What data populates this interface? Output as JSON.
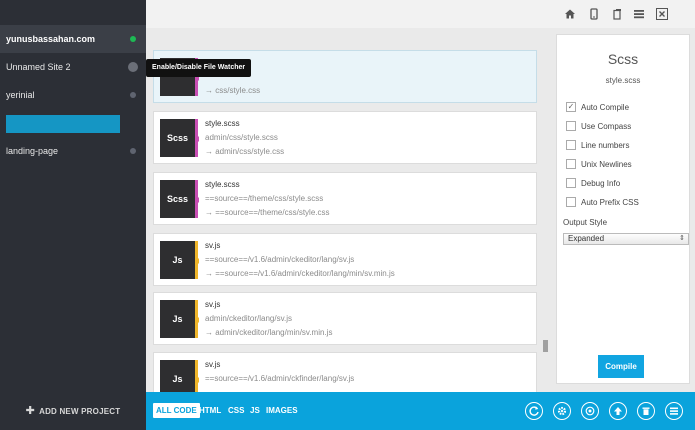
{
  "sidebar": {
    "projects": [
      {
        "name": "yunusbassahan.com",
        "active": true
      },
      {
        "name": "Unnamed Site 2"
      },
      {
        "name": "yerinial"
      },
      {
        "name": "landing-page"
      }
    ],
    "add_project_label": "ADD NEW PROJECT"
  },
  "tooltip": "Enable/Disable File Watcher",
  "topbar_icons": [
    "home-icon",
    "mobile-icon",
    "copy-icon",
    "menu-icon",
    "close-icon"
  ],
  "files": [
    {
      "badge": "",
      "name": "",
      "source": "",
      "output": "→ css/style.css",
      "type": "scss"
    },
    {
      "badge": "Scss",
      "name": "style.scss",
      "source": "admin/css/style.scss",
      "output": "→ admin/css/style.css",
      "type": "scss"
    },
    {
      "badge": "Scss",
      "name": "style.scss",
      "source": "==source==/theme/css/style.scss",
      "output": "→ ==source==/theme/css/style.css",
      "type": "scss"
    },
    {
      "badge": "Js",
      "name": "sv.js",
      "source": "==source==/v1.6/admin/ckeditor/lang/sv.js",
      "output": "→ ==source==/v1.6/admin/ckeditor/lang/min/sv.min.js",
      "type": "js"
    },
    {
      "badge": "Js",
      "name": "sv.js",
      "source": "admin/ckeditor/lang/sv.js",
      "output": "→ admin/ckeditor/lang/min/sv.min.js",
      "type": "js"
    },
    {
      "badge": "Js",
      "name": "sv.js",
      "source": "==source==/v1.6/admin/ckfinder/lang/sv.js",
      "output": "",
      "type": "js"
    }
  ],
  "panel": {
    "title": "Scss",
    "filename": "style.scss",
    "options": [
      {
        "label": "Auto Compile",
        "checked": true
      },
      {
        "label": "Use Compass",
        "checked": false
      },
      {
        "label": "Line numbers",
        "checked": false
      },
      {
        "label": "Unix Newlines",
        "checked": false
      },
      {
        "label": "Debug Info",
        "checked": false
      },
      {
        "label": "Auto Prefix CSS",
        "checked": false
      }
    ],
    "output_style_label": "Output Style",
    "output_style_value": "Expanded",
    "compile_label": "Compile"
  },
  "filters": [
    "ALL CODE",
    "HTML",
    "CSS",
    "JS",
    "IMAGES"
  ],
  "active_filter": "ALL CODE",
  "bottom_icons": [
    "refresh-icon",
    "settings-icon",
    "target-icon",
    "upload-icon",
    "trash-icon",
    "list-icon"
  ],
  "colors": {
    "sidebar": "#2c2f36",
    "accent": "#0aa3dc",
    "scss_accent": "#c94fb4",
    "js_accent": "#f0b62b",
    "watch_on": "#1db954"
  }
}
